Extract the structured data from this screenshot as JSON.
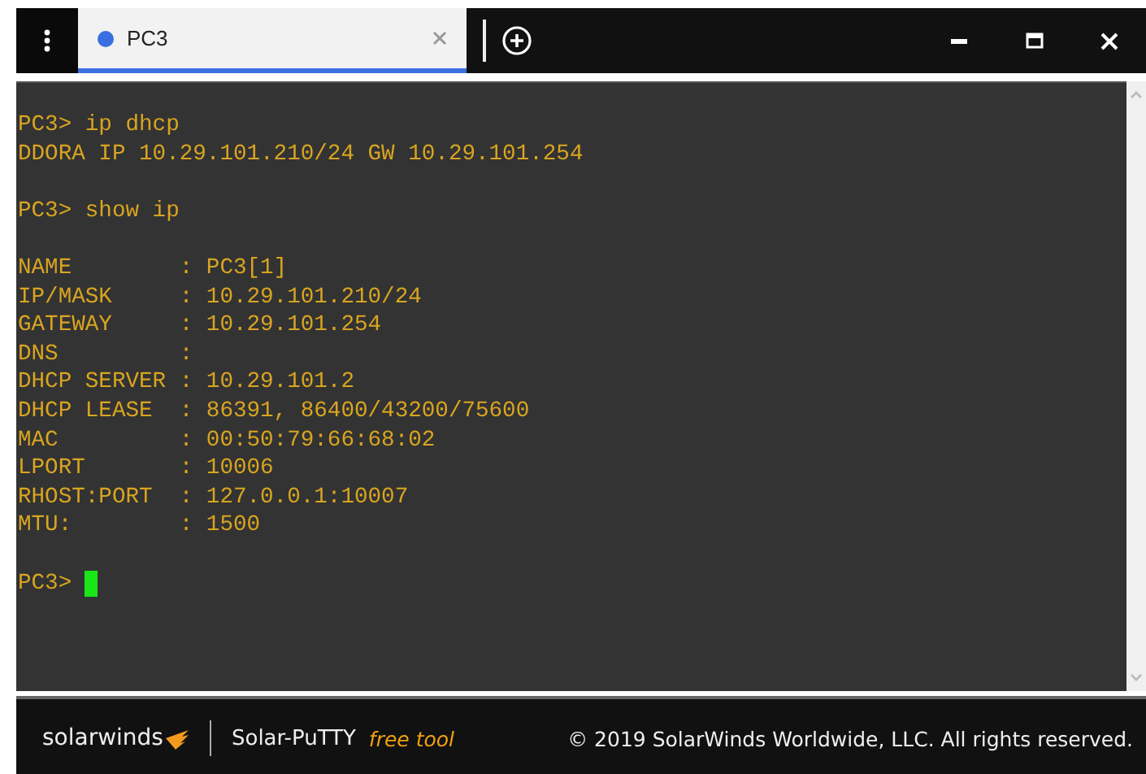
{
  "tabs": [
    {
      "label": "PC3",
      "selected": true,
      "color": "#3b6fe0"
    }
  ],
  "terminal": {
    "blocks": [
      [
        "PC3> ip dhcp",
        "DDORA IP 10.29.101.210/24 GW 10.29.101.254"
      ],
      [
        "PC3> show ip"
      ],
      [
        "NAME        : PC3[1]",
        "IP/MASK     : 10.29.101.210/24",
        "GATEWAY     : 10.29.101.254",
        "DNS         :",
        "DHCP SERVER : 10.29.101.2",
        "DHCP LEASE  : 86391, 86400/43200/75600",
        "MAC         : 00:50:79:66:68:02",
        "LPORT       : 10006",
        "RHOST:PORT  : 127.0.0.1:10007",
        "MTU:        : 1500"
      ]
    ],
    "prompt": "PC3>",
    "cursor": true
  },
  "footer": {
    "brand": "solarwinds",
    "product": "Solar-PuTTY",
    "edition": "free tool",
    "copyright": "© 2019 SolarWinds Worldwide, LLC. All rights reserved."
  }
}
